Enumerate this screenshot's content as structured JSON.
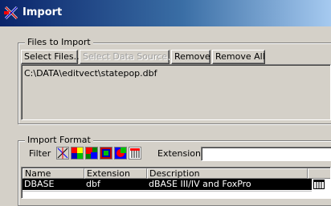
{
  "window": {
    "title": "Import"
  },
  "files_group": {
    "legend": "Files to Import",
    "buttons": {
      "select_files": "Select Files...",
      "select_data_source": "Select Data Source...",
      "remove": "Remove",
      "remove_all": "Remove All"
    },
    "files": [
      "C:\\DATA\\editvect\\statepop.dbf"
    ]
  },
  "format_group": {
    "legend": "Import Format",
    "filter_label": "Filter",
    "filter_icons": [
      "vector-filter-icon",
      "raster-filter-icon",
      "raster-filter-icon-2",
      "raster-filter-icon-3",
      "database-filter-icon"
    ],
    "extension_label": "Extension",
    "extension_value": "",
    "table": {
      "headers": [
        "Name",
        "Extension",
        "Description"
      ],
      "rows": [
        {
          "name": "DBASE",
          "extension": "dbf",
          "description": "dBASE III/IV and FoxPro"
        }
      ]
    }
  },
  "colors": {
    "title_start": "#0a246a",
    "title_end": "#a6caf0",
    "face": "#d4d0c8",
    "selection": "#000000"
  }
}
